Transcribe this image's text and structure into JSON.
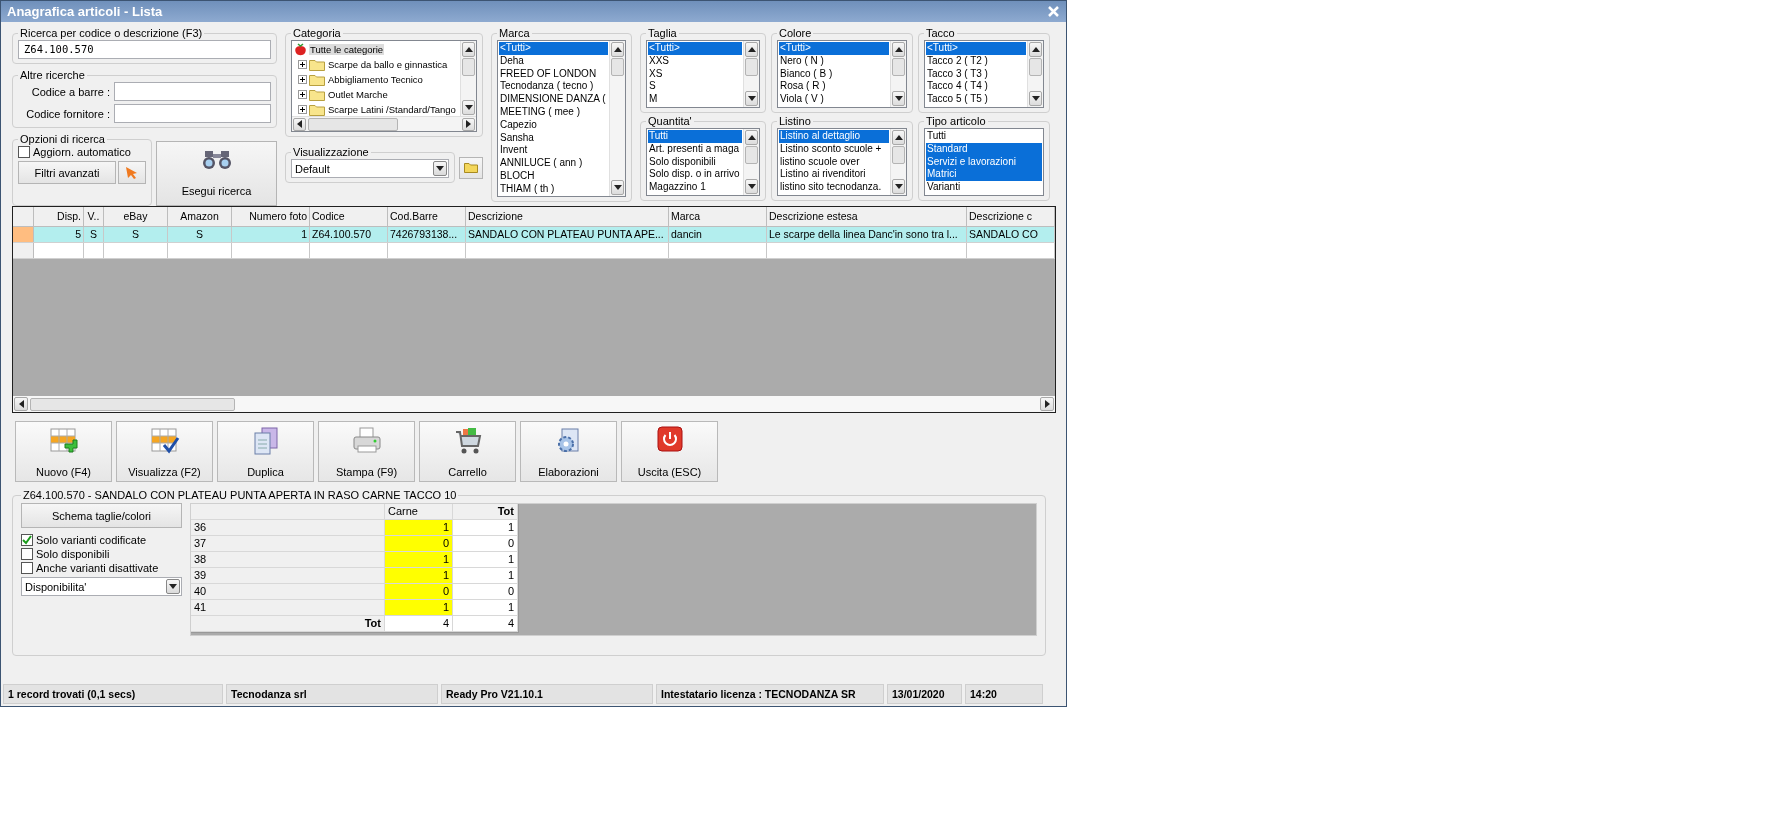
{
  "window": {
    "title": "Anagrafica articoli  - Lista"
  },
  "search": {
    "label": "Ricerca per codice o descrizione (F3)",
    "value": "Z64.100.570"
  },
  "other_searches": {
    "label": "Altre ricerche",
    "fields": [
      {
        "label": "Codice a barre :"
      },
      {
        "label": "Codice fornitore :"
      }
    ]
  },
  "search_options": {
    "label": "Opzioni di ricerca",
    "auto_update": {
      "label": "Aggiorn. automatico",
      "checked": false
    },
    "advanced_filters": "Filtri avanzati"
  },
  "run_search": "Esegui ricerca",
  "category": {
    "label": "Categoria",
    "tree": [
      {
        "label": "Tutte le categorie",
        "selected": true,
        "children": [
          {
            "label": "Scarpe da ballo e ginnastica",
            "expanded": false
          },
          {
            "label": "Abbigliamento Tecnico",
            "expanded": false
          },
          {
            "label": "Outlet Marche",
            "expanded": false
          },
          {
            "label": "Scarpe Latini /Standard/Tango",
            "expanded": false
          }
        ]
      }
    ]
  },
  "view": {
    "label": "Visualizzazione",
    "value": "Default"
  },
  "filters_top": [
    {
      "label": "Taglia",
      "scrollbar": true,
      "items": [
        {
          "label": "<Tutti>",
          "selected": true
        },
        {
          "label": "XXS",
          "selected": false
        },
        {
          "label": "XS",
          "selected": false
        },
        {
          "label": "S",
          "selected": false
        },
        {
          "label": "M",
          "selected": false
        }
      ]
    },
    {
      "label": "Colore",
      "scrollbar": true,
      "items": [
        {
          "label": "<Tutti>",
          "selected": true
        },
        {
          "label": "Nero ( N )",
          "selected": false
        },
        {
          "label": "Bianco ( B )",
          "selected": false
        },
        {
          "label": "Rosa ( R )",
          "selected": false
        },
        {
          "label": "Viola ( V )",
          "selected": false
        }
      ]
    },
    {
      "label": "Tacco",
      "scrollbar": true,
      "items": [
        {
          "label": "<Tutti>",
          "selected": true
        },
        {
          "label": "Tacco 2 ( T2 )",
          "selected": false
        },
        {
          "label": "Tacco 3 ( T3 )",
          "selected": false
        },
        {
          "label": "Tacco 4 ( T4 )",
          "selected": false
        },
        {
          "label": "Tacco 5 ( T5 )",
          "selected": false
        }
      ]
    }
  ],
  "filters_bottom": [
    {
      "label": "Quantita'",
      "scrollbar": true,
      "items": [
        {
          "label": "Tutti",
          "selected": true
        },
        {
          "label": "Art. presenti a maga",
          "selected": false
        },
        {
          "label": "Solo disponibili",
          "selected": false
        },
        {
          "label": "Solo disp. o in arrivo",
          "selected": false
        },
        {
          "label": "Magazzino 1",
          "selected": false
        }
      ]
    },
    {
      "label": "Listino",
      "scrollbar": true,
      "items": [
        {
          "label": "Listino al dettaglio",
          "selected": true
        },
        {
          "label": "Listino sconto scuole +",
          "selected": false
        },
        {
          "label": "listino scuole over",
          "selected": false
        },
        {
          "label": "Listino ai rivenditori",
          "selected": false
        },
        {
          "label": "listino sito tecnodanza.",
          "selected": false
        }
      ]
    },
    {
      "label": "Tipo articolo",
      "scrollbar": false,
      "items": [
        {
          "label": "Tutti",
          "selected": false
        },
        {
          "label": "Standard",
          "selected": true
        },
        {
          "label": "Servizi e lavorazioni",
          "selected": true
        },
        {
          "label": "Matrici",
          "selected": true
        },
        {
          "label": "Varianti",
          "selected": false
        }
      ]
    }
  ],
  "brand": {
    "label": "Marca",
    "scrollbar": true,
    "items": [
      {
        "label": "<Tutti>",
        "selected": true
      },
      {
        "label": "Deha",
        "selected": false
      },
      {
        "label": "FREED OF LONDON",
        "selected": false
      },
      {
        "label": "Tecnodanza ( tecno )",
        "selected": false
      },
      {
        "label": "DIMENSIONE DANZA (",
        "selected": false
      },
      {
        "label": "MEETING ( mee )",
        "selected": false
      },
      {
        "label": "Capezio",
        "selected": false
      },
      {
        "label": "Sansha",
        "selected": false
      },
      {
        "label": "Invent",
        "selected": false
      },
      {
        "label": "ANNILUCE ( ann )",
        "selected": false
      },
      {
        "label": "BLOCH",
        "selected": false
      },
      {
        "label": "THIAM ( th )",
        "selected": false
      }
    ]
  },
  "table": {
    "columns": [
      "Disp.",
      "V..",
      "eBay",
      "Amazon",
      "Numero foto",
      "Codice",
      "Cod.Barre",
      "Descrizione",
      "Marca",
      "Descrizione estesa",
      "Descrizione c"
    ],
    "rows": [
      {
        "selected": true,
        "cells": [
          "5",
          "S",
          "S",
          "S",
          "1",
          "Z64.100.570",
          "7426793138...",
          "SANDALO CON PLATEAU PUNTA APE...",
          "dancin",
          "Le scarpe della linea Danc'in sono tra l...",
          "SANDALO CO"
        ]
      },
      {
        "selected": false,
        "cells": []
      }
    ]
  },
  "actions": [
    {
      "label": "Nuovo (F4)",
      "kind": "new"
    },
    {
      "label": "Visualizza (F2)",
      "kind": "view"
    },
    {
      "label": "Duplica",
      "kind": "duplicate"
    },
    {
      "label": "Stampa (F9)",
      "kind": "print"
    },
    {
      "label": "Carrello",
      "kind": "cart"
    },
    {
      "label": "Elaborazioni",
      "kind": "process"
    },
    {
      "label": "Uscita (ESC)",
      "kind": "exit"
    }
  ],
  "detail": {
    "title": "Z64.100.570 - SANDALO CON PLATEAU PUNTA APERTA IN RASO CARNE TACCO 10",
    "scheme_button": "Schema taglie/colori",
    "options": [
      {
        "label": "Solo varianti codificate",
        "checked": true
      },
      {
        "label": "Solo disponibili",
        "checked": false
      },
      {
        "label": "Anche varianti disattivate",
        "checked": false
      }
    ],
    "mode": "Disponibilita'",
    "matrix": {
      "columns": [
        "Carne",
        "Tot"
      ],
      "rows": [
        {
          "size": "36",
          "values": [
            "1",
            "1"
          ]
        },
        {
          "size": "37",
          "values": [
            "0",
            "0"
          ]
        },
        {
          "size": "38",
          "values": [
            "1",
            "1"
          ]
        },
        {
          "size": "39",
          "values": [
            "1",
            "1"
          ]
        },
        {
          "size": "40",
          "values": [
            "0",
            "0"
          ]
        },
        {
          "size": "41",
          "values": [
            "1",
            "1"
          ]
        }
      ],
      "total": {
        "label": "Tot",
        "values": [
          "4",
          "4"
        ]
      }
    }
  },
  "status_bar": [
    "1 record trovati (0,1 secs)",
    "Tecnodanza srl",
    "Ready Pro V21.10.1",
    "Intestatario licenza : TECNODANZA SR",
    "13/01/2020",
    "14:20"
  ]
}
